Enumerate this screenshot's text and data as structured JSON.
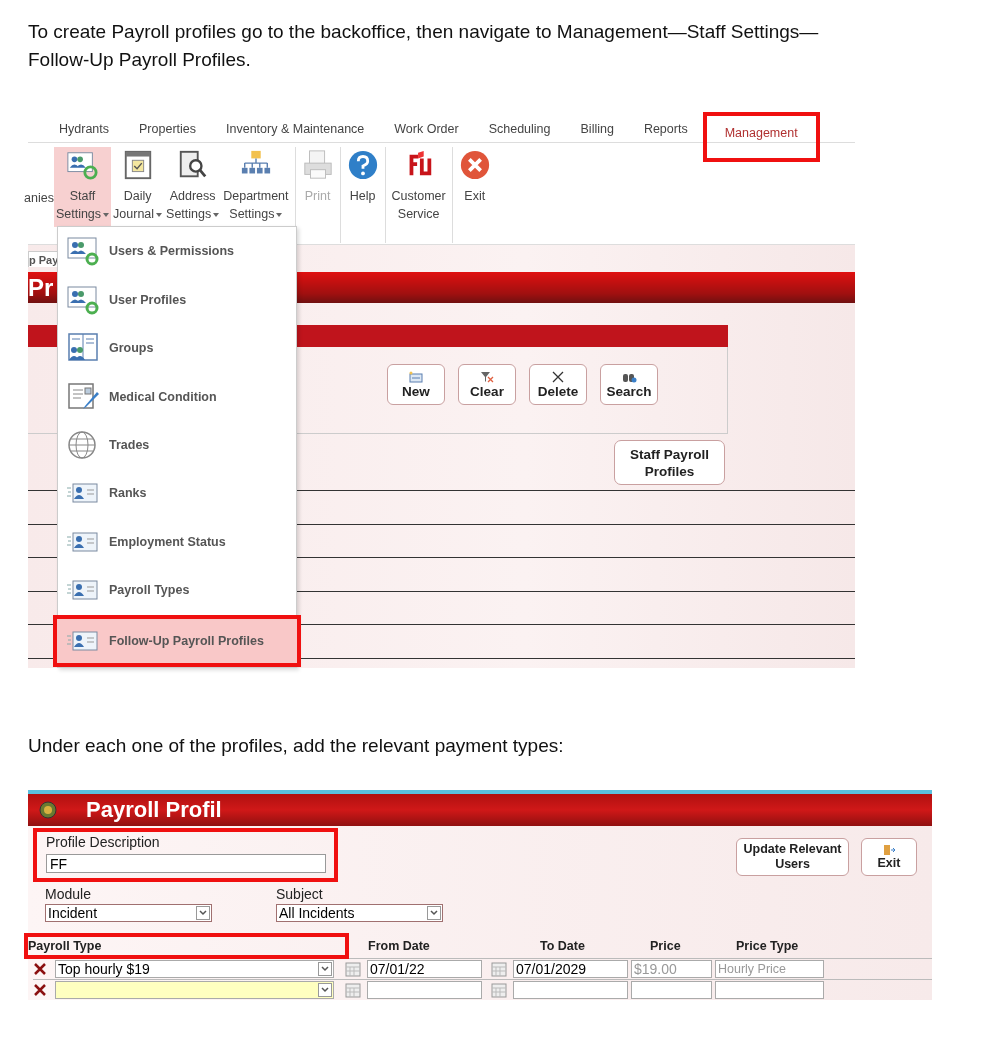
{
  "intro_text": "To create Payroll profiles go to the backoffice, then navigate to Management—Staff Settings—Follow-Up Payroll Profiles.",
  "screenshot_1": {
    "ribbon_tabs": [
      {
        "label": "Hydrants",
        "selected": false
      },
      {
        "label": "Properties",
        "selected": false
      },
      {
        "label": "Inventory & Maintenance",
        "selected": false
      },
      {
        "label": "Work Order",
        "selected": false
      },
      {
        "label": "Scheduling",
        "selected": false
      },
      {
        "label": "Billing",
        "selected": false
      },
      {
        "label": "Reports",
        "selected": false
      },
      {
        "label": "Management",
        "selected": true
      }
    ],
    "ribbon_buttons": [
      {
        "kind": "partial",
        "lines": [
          "anies"
        ],
        "dropdown": false,
        "selected": false,
        "disabled": false
      },
      {
        "kind": "staff",
        "lines": [
          "Staff",
          "Settings"
        ],
        "dropdown": true,
        "selected": true,
        "disabled": false
      },
      {
        "kind": "journal",
        "lines": [
          "Daily",
          "Journal"
        ],
        "dropdown": true,
        "selected": false,
        "disabled": false
      },
      {
        "kind": "address",
        "lines": [
          "Address",
          "Settings"
        ],
        "dropdown": true,
        "selected": false,
        "disabled": false
      },
      {
        "kind": "department",
        "lines": [
          "Department",
          "Settings"
        ],
        "dropdown": true,
        "selected": false,
        "disabled": false
      },
      {
        "kind": "print",
        "lines": [
          "Print"
        ],
        "dropdown": false,
        "selected": false,
        "disabled": true
      },
      {
        "kind": "help",
        "lines": [
          "Help"
        ],
        "dropdown": false,
        "selected": false,
        "disabled": false
      },
      {
        "kind": "service",
        "lines": [
          "Customer",
          "Service"
        ],
        "dropdown": false,
        "selected": false,
        "disabled": false
      },
      {
        "kind": "exit",
        "lines": [
          "Exit"
        ],
        "dropdown": false,
        "selected": false,
        "disabled": false
      }
    ],
    "breadcrumb": "p Pay",
    "page_title": "Pr",
    "toolbar_buttons": [
      {
        "kind": "new",
        "label": "New"
      },
      {
        "kind": "clear",
        "label": "Clear"
      },
      {
        "kind": "delete",
        "label": "Delete"
      },
      {
        "kind": "search",
        "label": "Search"
      }
    ],
    "staff_payroll_button": "Staff Payroll Profiles",
    "menu": [
      {
        "kind": "users",
        "label": "Users & Permissions",
        "selected": false
      },
      {
        "kind": "users",
        "label": "User Profiles",
        "selected": false
      },
      {
        "kind": "groups",
        "label": "Groups",
        "selected": false
      },
      {
        "kind": "medical",
        "label": "Medical Condition",
        "selected": false
      },
      {
        "kind": "trades",
        "label": "Trades",
        "selected": false
      },
      {
        "kind": "card",
        "label": "Ranks",
        "selected": false
      },
      {
        "kind": "card",
        "label": "Employment Status",
        "selected": false
      },
      {
        "kind": "card",
        "label": "Payroll Types",
        "selected": false
      },
      {
        "kind": "card",
        "label": "Follow-Up Payroll Profiles",
        "selected": true
      }
    ]
  },
  "instruction_text": "Under each one of the profiles, add the relevant payment types:",
  "screenshot_2": {
    "title": "Payroll Profil",
    "profile_description": {
      "label": "Profile Description",
      "value": "FF",
      "highlighted": true
    },
    "module": {
      "label": "Module",
      "value": "Incident"
    },
    "subject": {
      "label": "Subject",
      "value": "All Incidents"
    },
    "buttons": [
      {
        "kind": "text",
        "label": "Update Relevant Users"
      },
      {
        "kind": "exit",
        "label": "Exit"
      }
    ],
    "columns": [
      {
        "label": "Payroll Type",
        "highlighted": true
      },
      {
        "label": "From Date",
        "highlighted": false
      },
      {
        "label": "To Date",
        "highlighted": false
      },
      {
        "label": "Price",
        "highlighted": false
      },
      {
        "label": "Price Type",
        "highlighted": false
      }
    ],
    "rows": [
      {
        "payroll_type": "Top hourly $19",
        "from_date": "07/01/22",
        "to_date": "07/01/2029",
        "price": "$19.00",
        "price_type": "Hourly Price",
        "selected": false
      },
      {
        "selected": true
      }
    ]
  }
}
